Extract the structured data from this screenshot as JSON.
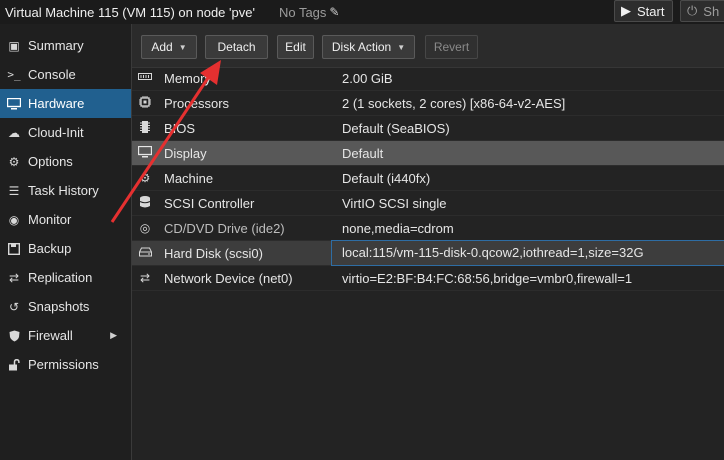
{
  "header": {
    "title": "Virtual Machine 115 (VM 115) on node 'pve'",
    "tags_label": "No Tags",
    "start_label": "Start",
    "shutdown_label": "Sh"
  },
  "sidebar": {
    "items": [
      {
        "label": "Summary",
        "icon": "book-icon"
      },
      {
        "label": "Console",
        "icon": "terminal-icon"
      },
      {
        "label": "Hardware",
        "icon": "monitor-icon",
        "active": true
      },
      {
        "label": "Cloud-Init",
        "icon": "cloud-icon"
      },
      {
        "label": "Options",
        "icon": "gear-icon"
      },
      {
        "label": "Task History",
        "icon": "list-icon"
      },
      {
        "label": "Monitor",
        "icon": "eye-icon"
      },
      {
        "label": "Backup",
        "icon": "floppy-icon"
      },
      {
        "label": "Replication",
        "icon": "retweet-icon"
      },
      {
        "label": "Snapshots",
        "icon": "history-icon"
      },
      {
        "label": "Firewall",
        "icon": "shield-icon"
      },
      {
        "label": "Permissions",
        "icon": "unlock-icon"
      }
    ]
  },
  "toolbar": {
    "add_label": "Add",
    "detach_label": "Detach",
    "edit_label": "Edit",
    "disk_action_label": "Disk Action",
    "revert_label": "Revert"
  },
  "hardware": {
    "rows": [
      {
        "label": "Memory",
        "value": "2.00 GiB",
        "icon": "memory-icon"
      },
      {
        "label": "Processors",
        "value": "2 (1 sockets, 2 cores) [x86-64-v2-AES]",
        "icon": "cpu-icon"
      },
      {
        "label": "BIOS",
        "value": "Default (SeaBIOS)",
        "icon": "microchip-icon"
      },
      {
        "label": "Display",
        "value": "Default",
        "icon": "desktop-icon"
      },
      {
        "label": "Machine",
        "value": "Default (i440fx)",
        "icon": "cogs-icon"
      },
      {
        "label": "SCSI Controller",
        "value": "VirtIO SCSI single",
        "icon": "database-icon"
      },
      {
        "label": "CD/DVD Drive (ide2)",
        "value": "none,media=cdrom",
        "icon": "cdrom-icon"
      },
      {
        "label": "Hard Disk (scsi0)",
        "value": "local:115/vm-115-disk-0.qcow2,iothread=1,size=32G",
        "icon": "hdd-icon"
      },
      {
        "label": "Network Device (net0)",
        "value": "virtio=E2:BF:B4:FC:68:56,bridge=vmbr0,firewall=1",
        "icon": "exchange-icon"
      }
    ]
  },
  "colors": {
    "accent": "#21608f",
    "annotation_arrow": "#e53030"
  }
}
